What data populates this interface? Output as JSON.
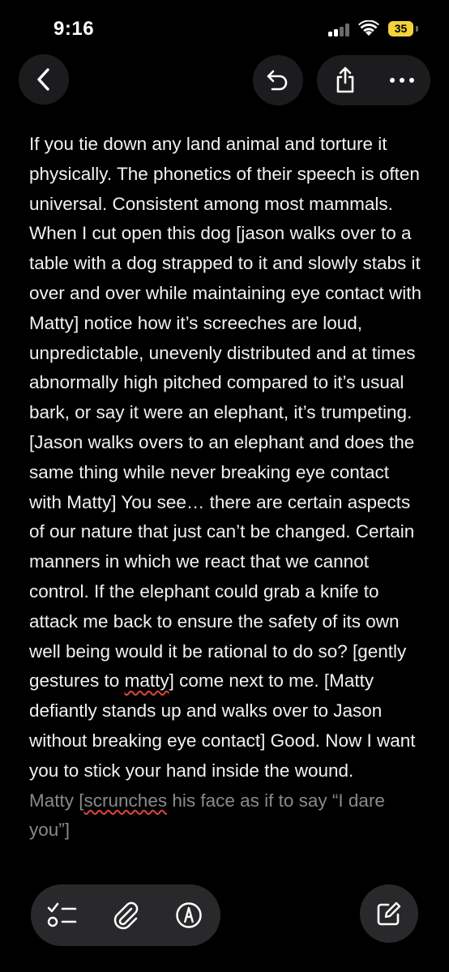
{
  "status_bar": {
    "time": "9:16",
    "battery_level": "35",
    "battery_color": "#f2d338"
  },
  "nav": {
    "back_icon": "chevron-left-icon",
    "undo_icon": "undo-icon",
    "share_icon": "share-icon",
    "more_icon": "ellipsis-icon"
  },
  "note": {
    "segments": [
      "If you tie down any land animal and torture it physically. The phonetics of their speech is often universal. Consistent among most mammals. When I cut open this dog [jason walks over to a table with a dog strapped to it and slowly stabs it over and over while maintaining eye contact with Matty] notice how it’s screeches are loud, unpredictable, unevenly distributed and at times abnormally high pitched compared to it’s usual bark, or say it were an elephant, it’s trumpeting. [Jason walks overs to an elephant and does the same thing while never breaking eye contact with Matty] You see… there are certain aspects of our nature that just can’t be changed. Certain manners in which we react that we cannot control. If the elephant could grab a knife to attack me back to ensure the safety of its own well being would it be rational to do so? [gently gestures to ",
      "matty",
      "] come next to me. [Matty defiantly stands up and walks over to Jason without breaking eye contact] Good. Now I want you to stick your hand inside the wound."
    ],
    "faded_segments": [
      "",
      "Matty",
      " [",
      "scrunches",
      " his face as if to say “I dare you”]"
    ]
  },
  "toolbar": {
    "checklist_icon": "checklist-icon",
    "attachment_icon": "paperclip-icon",
    "markup_icon": "pen-markup-icon",
    "compose_icon": "compose-icon"
  }
}
